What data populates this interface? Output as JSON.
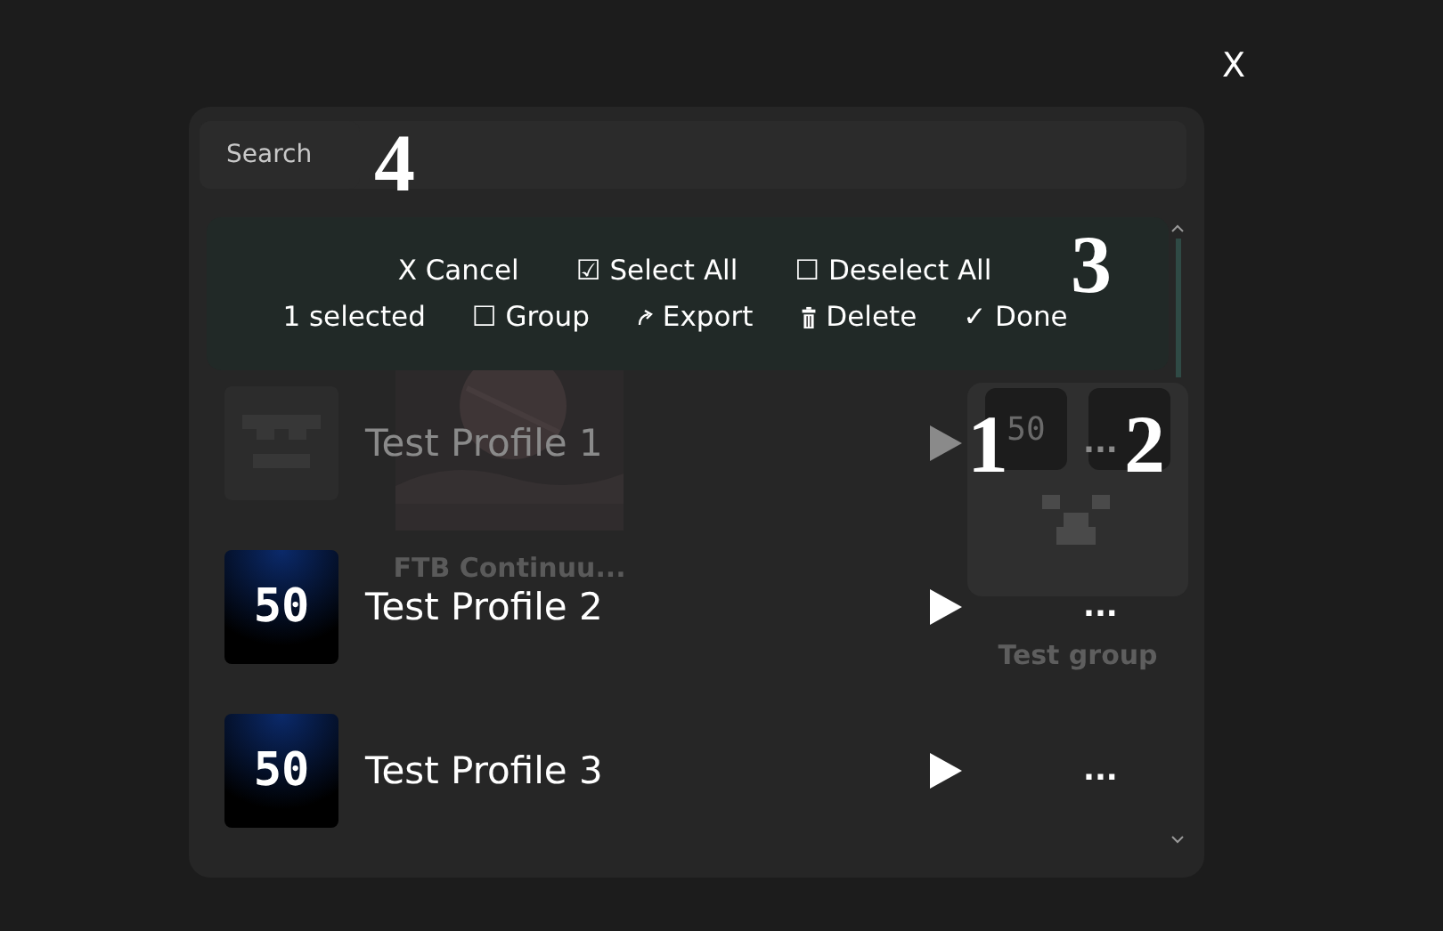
{
  "close": {
    "label": "X"
  },
  "search": {
    "placeholder": "Search",
    "annotation": "4"
  },
  "toolbar": {
    "annotation": "3",
    "top_actions": [
      {
        "label": "X Cancel"
      },
      {
        "label": "☑ Select All"
      },
      {
        "label": "☐ Deselect All"
      }
    ],
    "selected_count": "1 selected",
    "bottom_actions": [
      {
        "label": "☐ Group",
        "kind": "text"
      },
      {
        "label": "Export",
        "kind": "export"
      },
      {
        "label": "Delete",
        "kind": "delete"
      },
      {
        "label": "✓ Done",
        "kind": "text"
      }
    ]
  },
  "behind": {
    "pack": {
      "title": "FTB Continuu..."
    },
    "group": {
      "title": "Test group",
      "tile_text": "50"
    }
  },
  "profiles": [
    {
      "name": "Test Profile 1",
      "selected": true,
      "kind": "face",
      "play_annotation": "1",
      "menu_annotation": "2",
      "menu": "..."
    },
    {
      "name": "Test Profile 2",
      "selected": false,
      "kind": "logo",
      "logo_text": "50",
      "menu": "..."
    },
    {
      "name": "Test Profile 3",
      "selected": false,
      "kind": "logo",
      "logo_text": "50",
      "menu": "..."
    }
  ]
}
